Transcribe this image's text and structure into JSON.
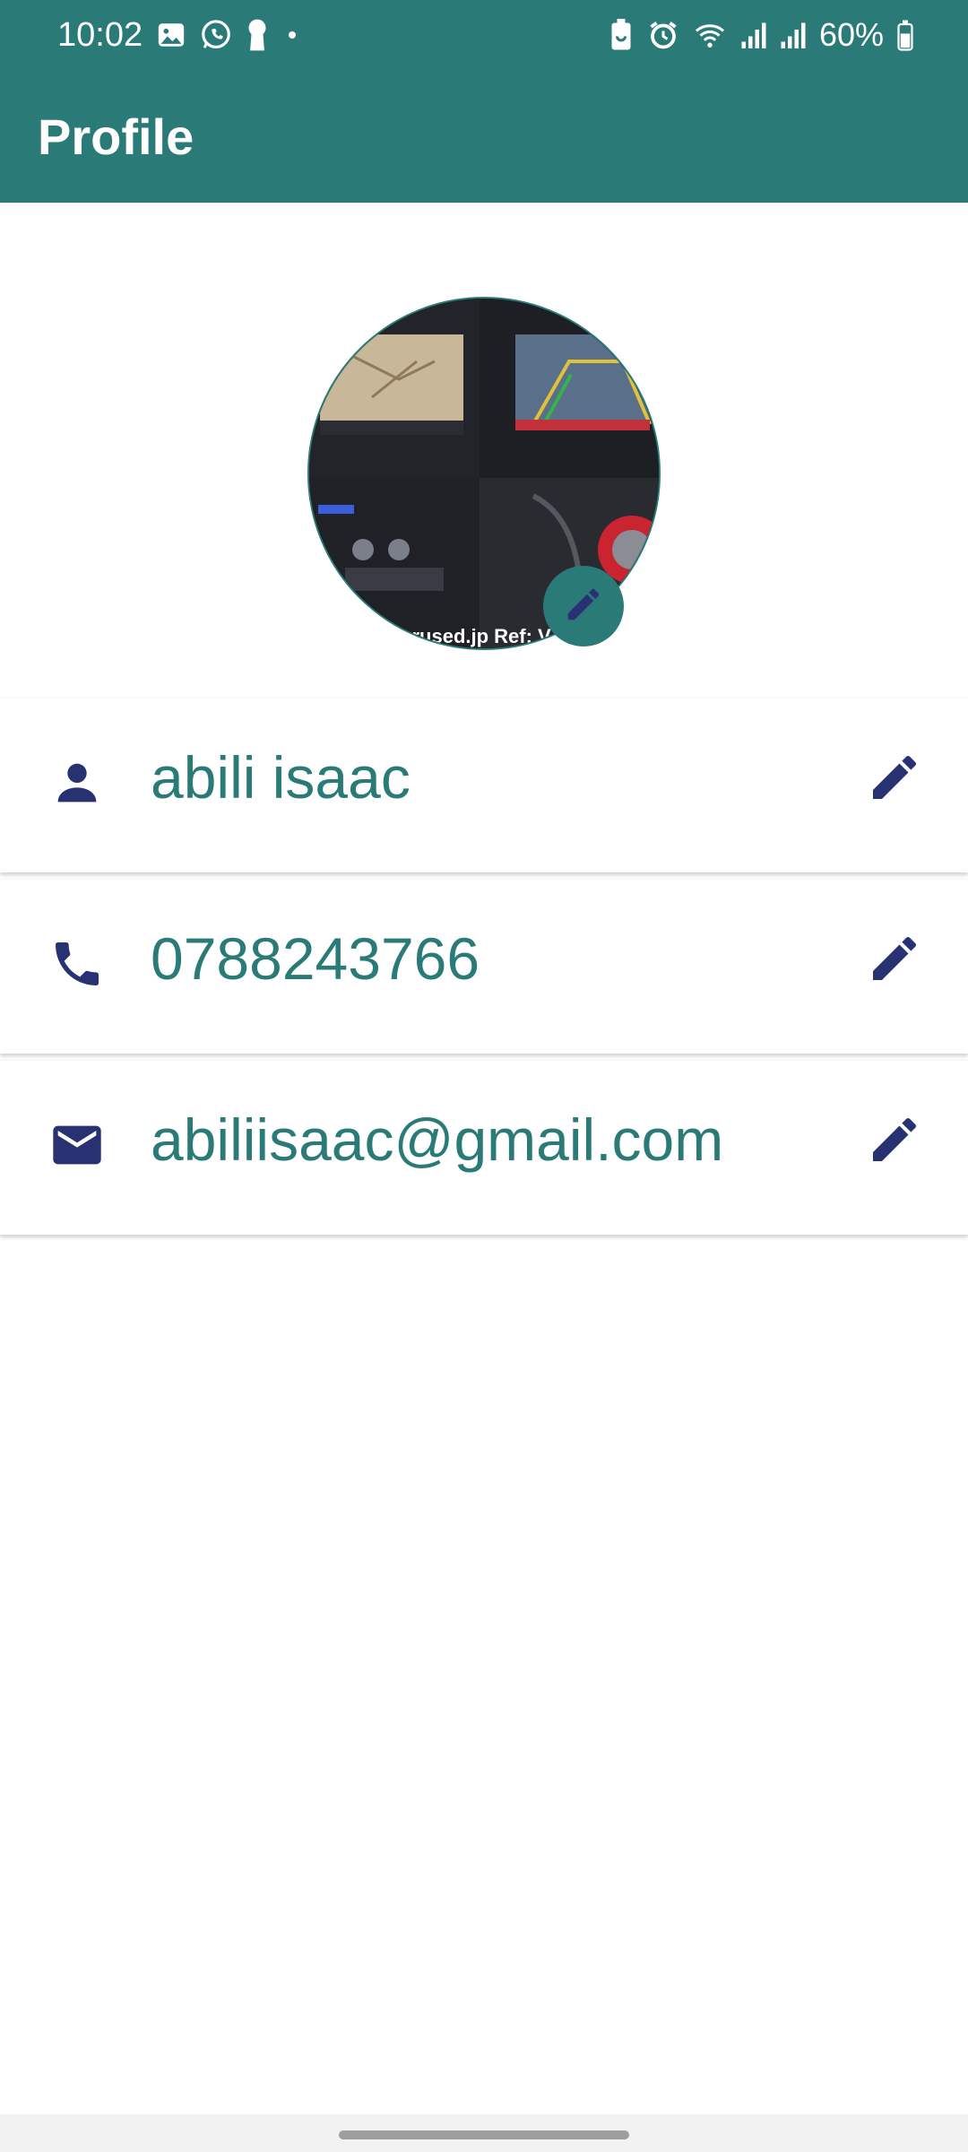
{
  "status_bar": {
    "time": "10:02",
    "battery": "60%",
    "left_icons": [
      "gallery-icon",
      "whatsapp-icon",
      "keyhole-icon",
      "dot-icon"
    ],
    "right_icons": [
      "battery-saver-icon",
      "alarm-icon",
      "wifi-icon",
      "signal-icon",
      "signal-icon",
      "battery-icon"
    ]
  },
  "app_bar": {
    "title": "Profile"
  },
  "avatar": {
    "overlay_text": "carused.jp Ref: V"
  },
  "fields": {
    "name": "abili isaac",
    "phone": "0788243766",
    "email": "abiliisaac@gmail.com"
  },
  "colors": {
    "primary": "#2a7a77",
    "icon": "#283273",
    "background": "#ffffff"
  }
}
